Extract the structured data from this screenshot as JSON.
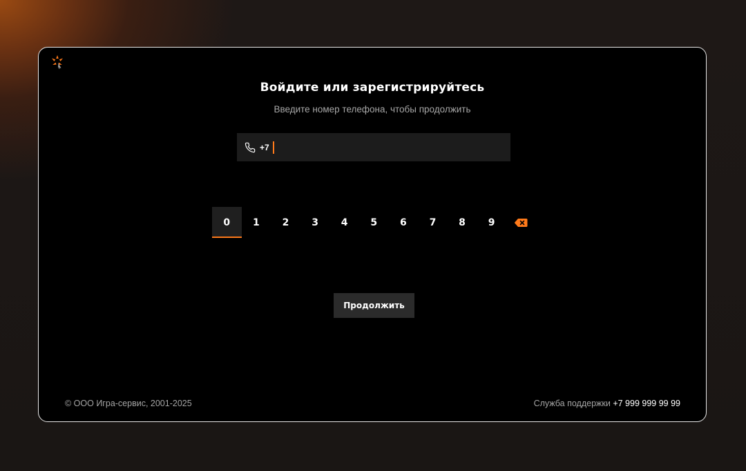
{
  "header": {
    "title": "Войдите или зарегистрируйтесь",
    "subtitle": "Введите номер телефона, чтобы продолжить"
  },
  "phone_field": {
    "icon": "phone-icon",
    "prefix": "+7",
    "value": ""
  },
  "keypad": {
    "keys": [
      "0",
      "1",
      "2",
      "3",
      "4",
      "5",
      "6",
      "7",
      "8",
      "9"
    ],
    "selected": "0",
    "backspace_icon": "backspace-icon",
    "accent_color": "#ff7a1a"
  },
  "continue_button": {
    "label": "Продолжить"
  },
  "footer": {
    "copyright": "© ООО Игра-сервис, 2001-2025",
    "support_label": "Служба поддержки",
    "support_phone": "+7 999 999 99 99"
  }
}
